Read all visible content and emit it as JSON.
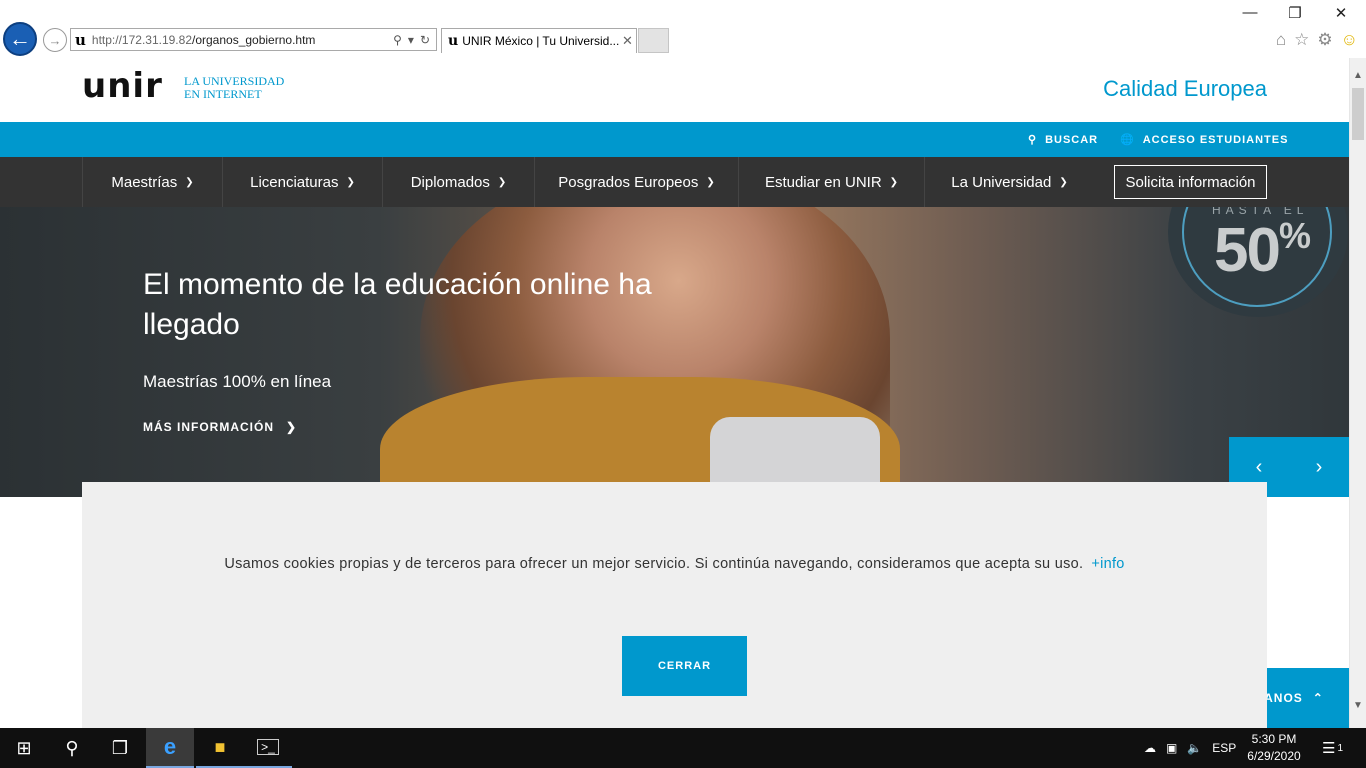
{
  "browser": {
    "url_host": "http://172.31.19.82",
    "url_path": "/organos_gobierno.htm",
    "tab_title": "UNIR México | Tu Universid...",
    "window_controls": [
      "minimize",
      "restore",
      "close"
    ]
  },
  "header": {
    "logo": "unir",
    "tagline_line1": "LA UNIVERSIDAD",
    "tagline_line2": "EN INTERNET",
    "calidad": "Calidad Europea"
  },
  "topbar": {
    "search_label": "BUSCAR",
    "access_label": "ACCESO ESTUDIANTES"
  },
  "nav": {
    "items": [
      {
        "label": "Maestrías"
      },
      {
        "label": "Licenciaturas"
      },
      {
        "label": "Diplomados"
      },
      {
        "label": "Posgrados Europeos"
      },
      {
        "label": "Estudiar en UNIR"
      },
      {
        "label": "La Universidad"
      }
    ],
    "cta": "Solicita información"
  },
  "hero": {
    "title": "El momento de la educación online ha llegado",
    "subtitle": "Maestrías 100% en línea",
    "link": "MÁS INFORMACIÓN",
    "badge_top": "HASTA EL",
    "badge_value": "50",
    "badge_unit": "%"
  },
  "cookie": {
    "text": "Usamos cookies propias y de terceros para ofrecer un mejor servicio. Si continúa navegando, consideramos que acepta su uso.",
    "more": "+info",
    "close": "CERRAR"
  },
  "floating": {
    "label": "ANOS"
  },
  "taskbar": {
    "language": "ESP",
    "time": "5:30 PM",
    "date": "6/29/2020",
    "notifications": "1"
  },
  "colors": {
    "accent": "#0098cd",
    "nav_bg": "#333333",
    "cookie_bg": "#efefef"
  }
}
